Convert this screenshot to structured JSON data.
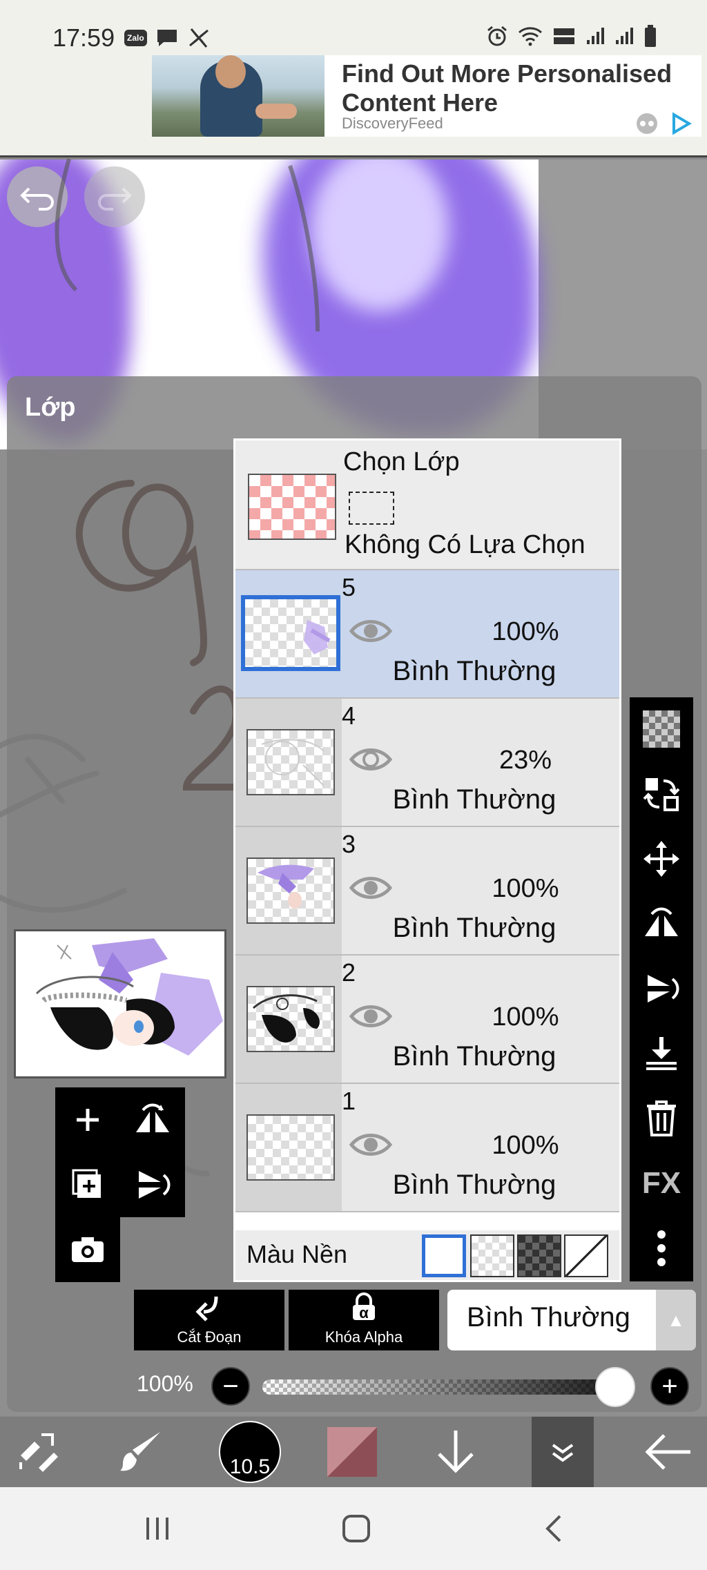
{
  "status_bar": {
    "time": "17:59",
    "zalo_label": "Zalo"
  },
  "ad": {
    "title": "Find Out More Personalised Content Here",
    "source": "DiscoveryFeed"
  },
  "panel": {
    "title": "Lớp"
  },
  "selection": {
    "title": "Chọn Lớp",
    "subtitle": "Không Có Lựa Chọn"
  },
  "layers": [
    {
      "number": "5",
      "opacity": "100%",
      "blend": "Bình Thường",
      "active": true
    },
    {
      "number": "4",
      "opacity": "23%",
      "blend": "Bình Thường",
      "active": false
    },
    {
      "number": "3",
      "opacity": "100%",
      "blend": "Bình Thường",
      "active": false
    },
    {
      "number": "2",
      "opacity": "100%",
      "blend": "Bình Thường",
      "active": false
    },
    {
      "number": "1",
      "opacity": "100%",
      "blend": "Bình Thường",
      "active": false
    }
  ],
  "background": {
    "label": "Màu Nền",
    "selected": "white"
  },
  "right_tools": {
    "fx_label": "FX"
  },
  "actions": {
    "clip_label": "Cắt Đoạn",
    "alpha_lock_label": "Khóa Alpha",
    "alpha_glyph": "α"
  },
  "blend_mode": {
    "value": "Bình Thường"
  },
  "opacity": {
    "label": "100%",
    "value": 1.0
  },
  "toolbar": {
    "brush_size": "10.5"
  },
  "colors": {
    "accent_blue": "#2f6fd6",
    "current_color": "#8e4e55",
    "paint_purple": "#7e55e6"
  }
}
